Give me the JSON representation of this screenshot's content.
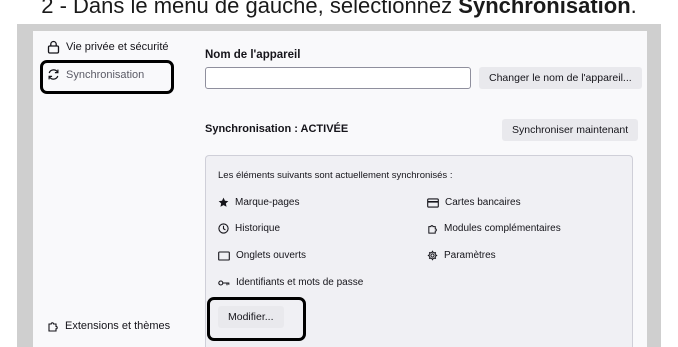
{
  "instruction": {
    "prefix": "2 - Dans le menu de gauche, sélectionnez ",
    "target": "Synchronisation",
    "suffix": "."
  },
  "sidebar": {
    "items": [
      {
        "label": "Vie privée et sécurité",
        "icon": "lock-icon"
      },
      {
        "label": "Synchronisation",
        "icon": "sync-icon",
        "selected": true
      },
      {
        "label": "Extensions et thèmes",
        "icon": "puzzle-icon"
      }
    ]
  },
  "device": {
    "label": "Nom de l'appareil",
    "value": "",
    "change_button": "Changer le nom de l'appareil..."
  },
  "sync": {
    "status": "Synchronisation : ACTIVÉE",
    "sync_now_button": "Synchroniser maintenant",
    "intro": "Les éléments suivants sont actuellement synchronisés :",
    "engines": [
      {
        "label": "Marque-pages",
        "icon": "star-icon"
      },
      {
        "label": "Cartes bancaires",
        "icon": "credit-card-icon"
      },
      {
        "label": "Historique",
        "icon": "clock-icon"
      },
      {
        "label": "Modules complémentaires",
        "icon": "puzzle-icon"
      },
      {
        "label": "Onglets ouverts",
        "icon": "tab-icon"
      },
      {
        "label": "Paramètres",
        "icon": "gear-icon"
      },
      {
        "label": "Identifiants et mots de passe",
        "icon": "key-icon"
      }
    ],
    "modify_button": "Modifier..."
  },
  "colors": {
    "highlight": "#000000",
    "panel_bg": "#f9f9fb",
    "sync_box_bg": "#f0f0f4",
    "button_bg": "#e9e9ed"
  }
}
